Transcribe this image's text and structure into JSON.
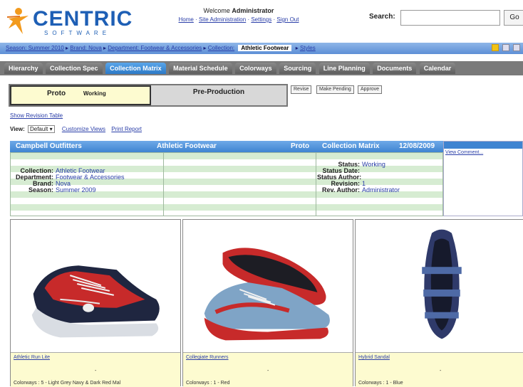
{
  "header": {
    "brand": "CENTRIC",
    "brand_sub": "SOFTWARE",
    "welcome_prefix": "Welcome",
    "welcome_user": "Administrator",
    "links": [
      "Home",
      "Site Administration",
      "Settings",
      "Sign Out"
    ],
    "search_label": "Search:",
    "search_value": "",
    "go_label": "Go"
  },
  "breadcrumb": {
    "items": [
      "Season: Summer 2010",
      "Brand: Nova",
      "Department: Footwear & Accessories",
      "Collection:"
    ],
    "current": "Athletic Footwear",
    "after": "Styles"
  },
  "tabs": [
    {
      "label": "Hierarchy",
      "active": false
    },
    {
      "label": "Collection Spec",
      "active": false
    },
    {
      "label": "Collection Matrix",
      "active": true
    },
    {
      "label": "Material Schedule",
      "active": false
    },
    {
      "label": "Colorways",
      "active": false
    },
    {
      "label": "Sourcing",
      "active": false
    },
    {
      "label": "Line Planning",
      "active": false
    },
    {
      "label": "Documents",
      "active": false
    },
    {
      "label": "Calendar",
      "active": false
    }
  ],
  "phases": {
    "current_name": "Proto",
    "current_status": "Working",
    "next_name": "Pre-Production"
  },
  "actions": [
    "Revise",
    "Make Pending",
    "Approve"
  ],
  "show_table_link": "Show Revision Table",
  "view": {
    "label": "View:",
    "selected": "Default",
    "customize": "Customize Views",
    "print": "Print Report"
  },
  "matrix_header": {
    "company": "Campbell Outfitters",
    "collection": "Athletic Footwear",
    "phase": "Proto",
    "page": "Collection Matrix",
    "date": "12/08/2009"
  },
  "details_left": [
    {
      "k": "Collection:",
      "v": "Athletic Footwear"
    },
    {
      "k": "Department:",
      "v": "Footwear & Accessories"
    },
    {
      "k": "Brand:",
      "v": "Nova"
    },
    {
      "k": "Season:",
      "v": "Summer 2009"
    }
  ],
  "details_right": [
    {
      "k": "Status:",
      "v": "Working"
    },
    {
      "k": "Status Date:",
      "v": ""
    },
    {
      "k": "Status Author:",
      "v": ""
    },
    {
      "k": "Revision:",
      "v": "1"
    },
    {
      "k": "Rev. Author:",
      "v": "Administrator"
    }
  ],
  "comment_link": "View Comment...",
  "products": [
    {
      "name": "Athletic Run Lite",
      "dash": "-",
      "colorways": "Colorways : 5 - Light Grey Navy & Dark Red Mal"
    },
    {
      "name": "Collegiate Runners",
      "dash": "-",
      "colorways": "Colorways : 1 - Red"
    },
    {
      "name": "Hybrid Sandal",
      "dash": "-",
      "colorways": "Colorways : 1 - Blue"
    }
  ],
  "colors": {
    "brand_blue": "#1e5fb5",
    "tab_active": "#2c79c6",
    "matrix_bar": "#3f84d1",
    "card_footer": "#fdfbd0",
    "row_green": "#d6ecd2"
  }
}
